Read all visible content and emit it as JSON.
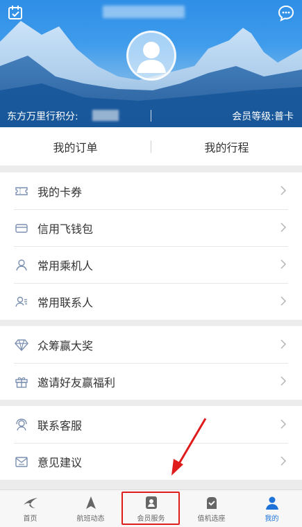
{
  "header": {
    "points_label": "东方万里行积分:",
    "level_label": "会员等级:普卡"
  },
  "orders": {
    "my_orders": "我的订单",
    "my_trips": "我的行程"
  },
  "group1": [
    {
      "label": "我的卡券",
      "icon": "ticket-icon"
    },
    {
      "label": "信用飞钱包",
      "icon": "wallet-icon"
    },
    {
      "label": "常用乘机人",
      "icon": "passenger-icon"
    },
    {
      "label": "常用联系人",
      "icon": "contact-icon"
    }
  ],
  "group2": [
    {
      "label": "众筹赢大奖",
      "icon": "diamond-icon"
    },
    {
      "label": "邀请好友赢福利",
      "icon": "gift-icon"
    }
  ],
  "group3": [
    {
      "label": "联系客服",
      "icon": "headset-icon"
    },
    {
      "label": "意见建议",
      "icon": "mail-icon"
    }
  ],
  "tabbar": [
    {
      "label": "首页",
      "icon": "swallow-icon"
    },
    {
      "label": "航班动态",
      "icon": "plane-icon"
    },
    {
      "label": "会员服务",
      "icon": "member-icon"
    },
    {
      "label": "值机选座",
      "icon": "seat-icon"
    },
    {
      "label": "我的",
      "icon": "user-icon"
    }
  ],
  "colors": {
    "accent": "#1f73d8",
    "highlight": "#e01b1b"
  }
}
